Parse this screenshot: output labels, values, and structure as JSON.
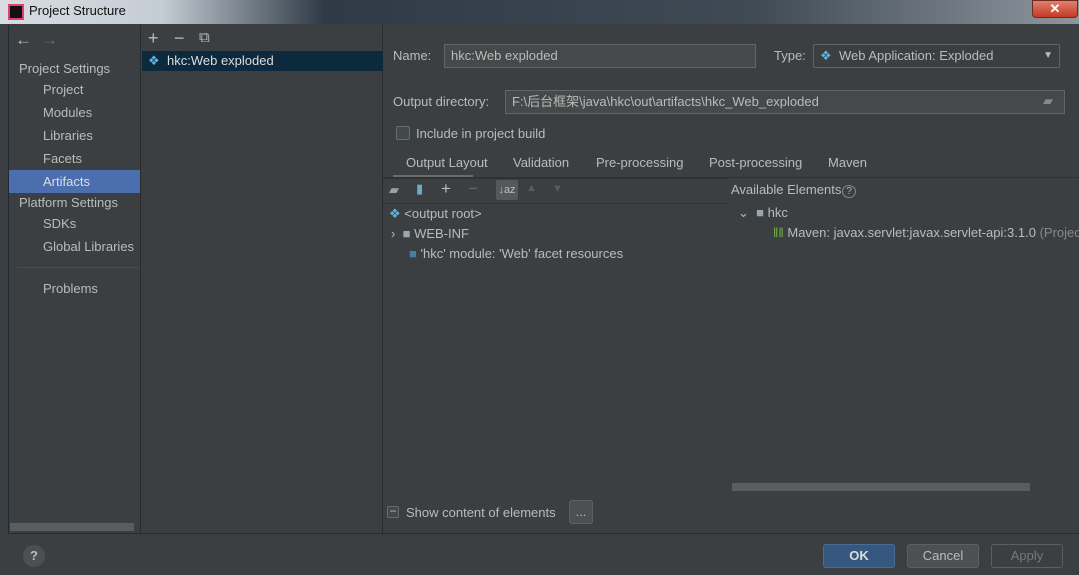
{
  "window": {
    "title": "Project Structure",
    "close": "✕"
  },
  "sidebar": {
    "back": "←",
    "forward": "→",
    "project_settings": "Project Settings",
    "project_items": [
      "Project",
      "Modules",
      "Libraries",
      "Facets",
      "Artifacts"
    ],
    "selected": "Artifacts",
    "platform_settings": "Platform Settings",
    "platform_items": [
      "SDKs",
      "Global Libraries"
    ],
    "problems": "Problems"
  },
  "artifacts": {
    "add": "+",
    "remove": "−",
    "copy": "⧉",
    "items": [
      "hkc:Web exploded"
    ]
  },
  "form": {
    "name_label": "Name:",
    "name_value": "hkc:Web exploded",
    "type_label": "Type:",
    "type_value": "Web Application: Exploded",
    "output_label": "Output directory:",
    "output_value": "F:\\后台框架\\java\\hkc\\out\\artifacts\\hkc_Web_exploded",
    "include_label": "Include in project build",
    "include_checked": false
  },
  "tabs": [
    "Output Layout",
    "Validation",
    "Pre-processing",
    "Post-processing",
    "Maven"
  ],
  "active_tab": "Output Layout",
  "layout_tree": [
    "<output root>",
    "WEB-INF",
    "'hkc' module: 'Web' facet resources"
  ],
  "available": {
    "title": "Available Elements",
    "help": "?",
    "module": "hkc",
    "library": "Maven: javax.servlet:javax.servlet-api:3.1.0",
    "library_suffix": "(Project"
  },
  "show_content": {
    "label": "Show content of elements",
    "button": "..."
  },
  "footer": {
    "help": "?",
    "ok": "OK",
    "cancel": "Cancel",
    "apply": "Apply"
  },
  "colors": {
    "selection": "#4b6eaf",
    "ok": "#365880",
    "background": "#3c3f41"
  }
}
